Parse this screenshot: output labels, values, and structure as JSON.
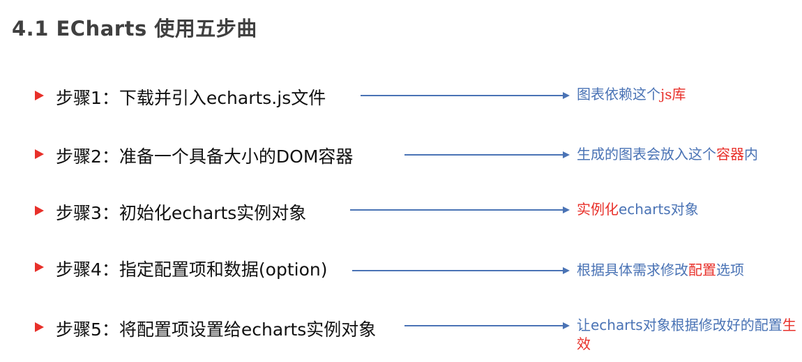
{
  "title": "4.1 ECharts 使用五步曲",
  "colors": {
    "title": "#404040",
    "bullet": "#e8302a",
    "arrow": "#4a73b5",
    "note": "#4a73b5",
    "highlight": "#e8302a"
  },
  "steps": [
    {
      "label": "步骤1：下载并引入echarts.js文件",
      "note": {
        "a": "图表依赖这个",
        "b": "js库"
      }
    },
    {
      "label": "步骤2：准备一个具备大小的DOM容器",
      "note": {
        "a": "生成的图表会放入这个",
        "b": "容器",
        "c": "内"
      }
    },
    {
      "label": "步骤3：初始化echarts实例对象",
      "note": {
        "a": "实例化",
        "b": "echarts",
        "c": "对象"
      }
    },
    {
      "label": "步骤4：指定配置项和数据(option)",
      "note": {
        "a": "根据具体需求修改",
        "b": "配置",
        "c": "选项"
      }
    },
    {
      "label": "步骤5：将配置项设置给echarts实例对象",
      "note": {
        "a": "让",
        "b": "echarts",
        "c": "对象根据修改好的配置",
        "d": "生效"
      }
    }
  ]
}
